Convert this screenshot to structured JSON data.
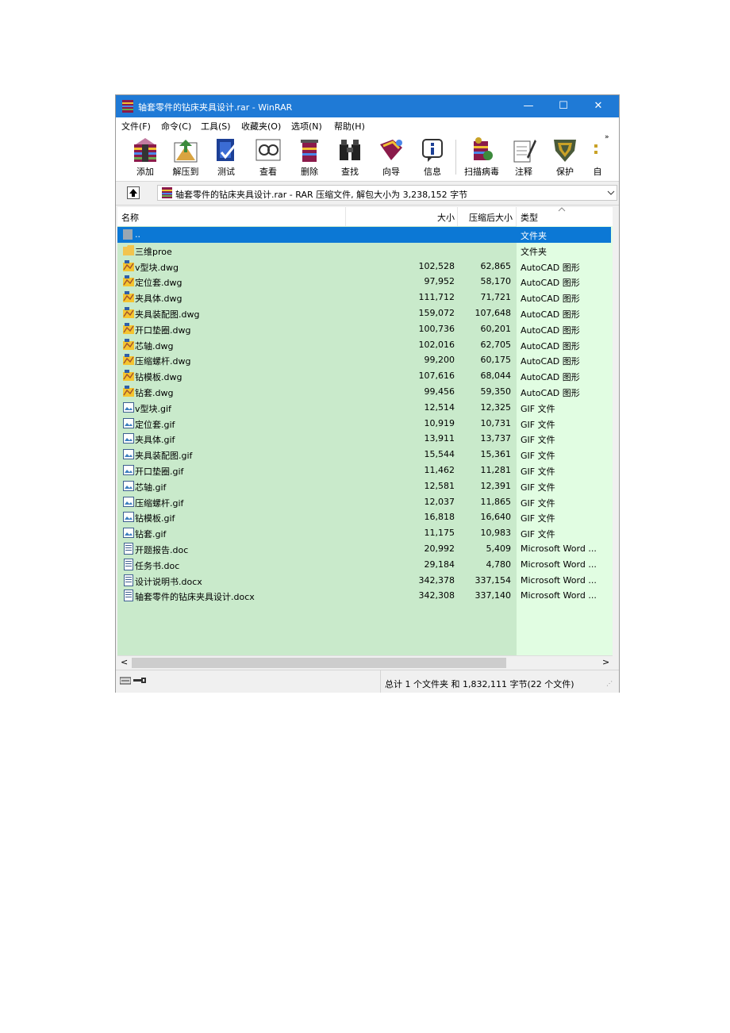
{
  "window": {
    "title": "轴套零件的钻床夹具设计.rar - WinRAR",
    "buttons": {
      "minimize": "—",
      "maximize": "☐",
      "close": "✕"
    }
  },
  "menu": [
    "文件(F)",
    "命令(C)",
    "工具(S)",
    "收藏夹(O)",
    "选项(N)",
    "帮助(H)"
  ],
  "toolbar": {
    "items": [
      {
        "label": "添加",
        "icon": "add-icon"
      },
      {
        "label": "解压到",
        "icon": "extract-icon"
      },
      {
        "label": "测试",
        "icon": "test-icon"
      },
      {
        "label": "查看",
        "icon": "view-icon"
      },
      {
        "label": "删除",
        "icon": "delete-icon"
      },
      {
        "label": "查找",
        "icon": "find-icon"
      },
      {
        "label": "向导",
        "icon": "wizard-icon"
      },
      {
        "label": "信息",
        "icon": "info-icon"
      },
      {
        "label": "扫描病毒",
        "icon": "virus-scan-icon"
      },
      {
        "label": "注释",
        "icon": "comment-icon"
      },
      {
        "label": "保护",
        "icon": "protect-icon"
      },
      {
        "label": "自",
        "icon": "sfx-icon"
      }
    ],
    "overflow": "»"
  },
  "address": {
    "path": "轴套零件的钻床夹具设计.rar - RAR 压缩文件, 解包大小为 3,238,152 字节"
  },
  "columns": {
    "name": "名称",
    "size": "大小",
    "packed": "压缩后大小",
    "type": "类型"
  },
  "files": [
    {
      "name": "..",
      "size": "",
      "packed": "",
      "type": "文件夹",
      "icon": "folder-up-icon"
    },
    {
      "name": "三维proe",
      "size": "",
      "packed": "",
      "type": "文件夹",
      "icon": "folder-icon"
    },
    {
      "name": "v型块.dwg",
      "size": "102,528",
      "packed": "62,865",
      "type": "AutoCAD 图形",
      "icon": "dwg-file-icon"
    },
    {
      "name": "定位套.dwg",
      "size": "97,952",
      "packed": "58,170",
      "type": "AutoCAD 图形",
      "icon": "dwg-file-icon"
    },
    {
      "name": "夹具体.dwg",
      "size": "111,712",
      "packed": "71,721",
      "type": "AutoCAD 图形",
      "icon": "dwg-file-icon"
    },
    {
      "name": "夹具装配图.dwg",
      "size": "159,072",
      "packed": "107,648",
      "type": "AutoCAD 图形",
      "icon": "dwg-file-icon"
    },
    {
      "name": "开口垫圈.dwg",
      "size": "100,736",
      "packed": "60,201",
      "type": "AutoCAD 图形",
      "icon": "dwg-file-icon"
    },
    {
      "name": "芯轴.dwg",
      "size": "102,016",
      "packed": "62,705",
      "type": "AutoCAD 图形",
      "icon": "dwg-file-icon"
    },
    {
      "name": "压缩螺杆.dwg",
      "size": "99,200",
      "packed": "60,175",
      "type": "AutoCAD 图形",
      "icon": "dwg-file-icon"
    },
    {
      "name": "钻模板.dwg",
      "size": "107,616",
      "packed": "68,044",
      "type": "AutoCAD 图形",
      "icon": "dwg-file-icon"
    },
    {
      "name": "钻套.dwg",
      "size": "99,456",
      "packed": "59,350",
      "type": "AutoCAD 图形",
      "icon": "dwg-file-icon"
    },
    {
      "name": "v型块.gif",
      "size": "12,514",
      "packed": "12,325",
      "type": "GIF 文件",
      "icon": "gif-file-icon"
    },
    {
      "name": "定位套.gif",
      "size": "10,919",
      "packed": "10,731",
      "type": "GIF 文件",
      "icon": "gif-file-icon"
    },
    {
      "name": "夹具体.gif",
      "size": "13,911",
      "packed": "13,737",
      "type": "GIF 文件",
      "icon": "gif-file-icon"
    },
    {
      "name": "夹具装配图.gif",
      "size": "15,544",
      "packed": "15,361",
      "type": "GIF 文件",
      "icon": "gif-file-icon"
    },
    {
      "name": "开口垫圈.gif",
      "size": "11,462",
      "packed": "11,281",
      "type": "GIF 文件",
      "icon": "gif-file-icon"
    },
    {
      "name": "芯轴.gif",
      "size": "12,581",
      "packed": "12,391",
      "type": "GIF 文件",
      "icon": "gif-file-icon"
    },
    {
      "name": "压缩螺杆.gif",
      "size": "12,037",
      "packed": "11,865",
      "type": "GIF 文件",
      "icon": "gif-file-icon"
    },
    {
      "name": "钻模板.gif",
      "size": "16,818",
      "packed": "16,640",
      "type": "GIF 文件",
      "icon": "gif-file-icon"
    },
    {
      "name": "钻套.gif",
      "size": "11,175",
      "packed": "10,983",
      "type": "GIF 文件",
      "icon": "gif-file-icon"
    },
    {
      "name": "开题报告.doc",
      "size": "20,992",
      "packed": "5,409",
      "type": "Microsoft Word ...",
      "icon": "word-file-icon"
    },
    {
      "name": "任务书.doc",
      "size": "29,184",
      "packed": "4,780",
      "type": "Microsoft Word ...",
      "icon": "word-file-icon"
    },
    {
      "name": "设计说明书.docx",
      "size": "342,378",
      "packed": "337,154",
      "type": "Microsoft Word ...",
      "icon": "word-file-icon"
    },
    {
      "name": "轴套零件的钻床夹具设计.docx",
      "size": "342,308",
      "packed": "337,140",
      "type": "Microsoft Word ...",
      "icon": "word-file-icon"
    }
  ],
  "scroll": {
    "left": "<",
    "right": ">"
  },
  "status": {
    "summary": "总计 1 个文件夹 和 1,832,111 字节(22 个文件)"
  },
  "colors": {
    "titlebar": "#1f7ad6",
    "selection": "#0c78d5",
    "list_bg": "#c9eacb",
    "type_col_bg": "#e1fde2"
  }
}
